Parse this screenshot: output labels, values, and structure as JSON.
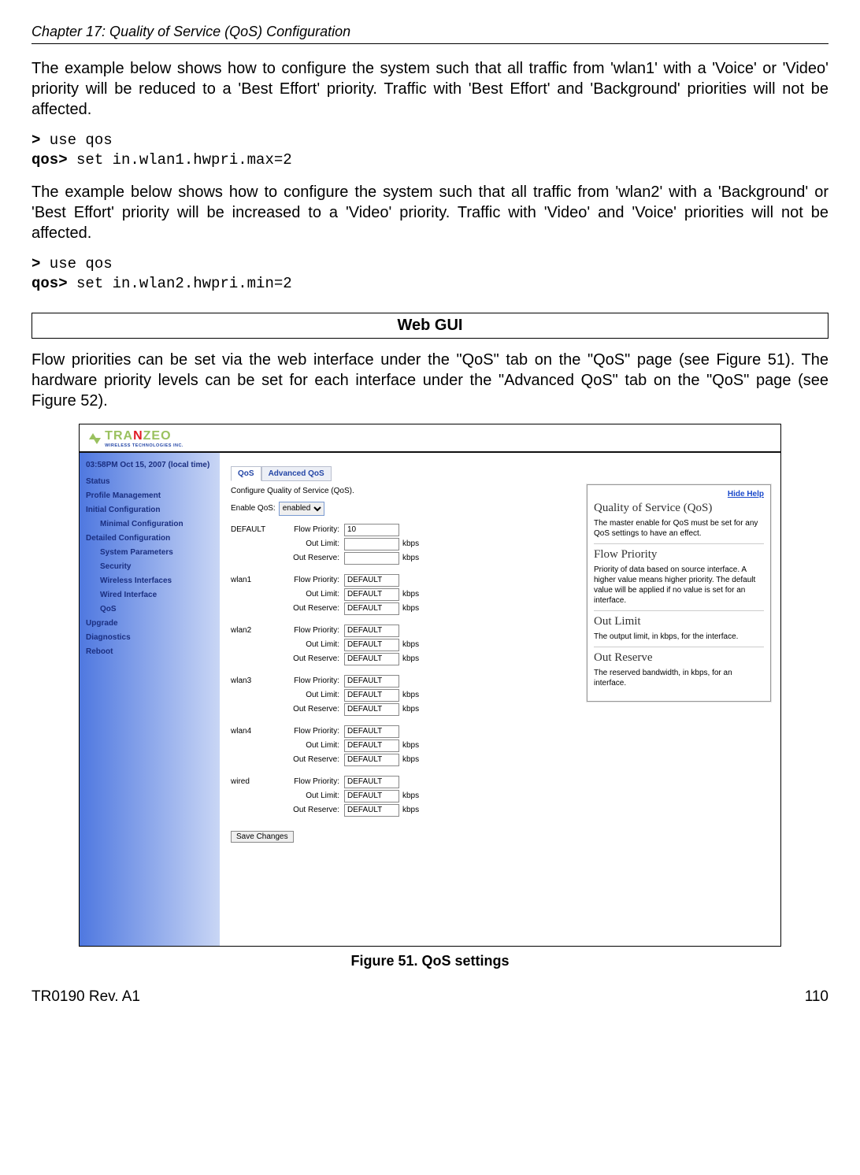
{
  "chapter": "Chapter 17: Quality of Service (QoS) Configuration",
  "para1": "The example below shows how to configure the system such that all traffic from 'wlan1' with a 'Voice' or 'Video' priority will be reduced to a 'Best Effort' priority. Traffic with 'Best Effort' and 'Background' priorities will not be affected.",
  "cli1_prompt1": ">",
  "cli1_cmd1": " use qos",
  "cli1_prompt2": "qos>",
  "cli1_cmd2": " set in.wlan1.hwpri.max=2",
  "para2": "The example below shows how to configure the system such that all traffic from 'wlan2' with a 'Background' or 'Best Effort' priority will be increased to a 'Video' priority. Traffic with 'Video' and 'Voice' priorities will not be affected.",
  "cli2_prompt1": ">",
  "cli2_cmd1": " use qos",
  "cli2_prompt2": "qos>",
  "cli2_cmd2": " set in.wlan2.hwpri.min=2",
  "webgui_title": "Web GUI",
  "para3": "Flow priorities can be set via the web interface under the \"QoS\" tab on the \"QoS\" page (see Figure 51). The hardware priority levels can be set for each interface under the \"Advanced QoS\" tab on the \"QoS\" page (see Figure 52).",
  "brand_main": "TRA",
  "brand_split": "N",
  "brand_end": "ZEO",
  "brand_sub": "WIRELESS TECHNOLOGIES INC.",
  "sidebar": {
    "localtime": "03:58PM Oct 15, 2007 (local time)",
    "items": [
      "Status",
      "Profile Management",
      "Initial Configuration",
      "Minimal Configuration",
      "Detailed Configuration",
      "System Parameters",
      "Security",
      "Wireless Interfaces",
      "Wired Interface",
      "QoS",
      "Upgrade",
      "Diagnostics",
      "Reboot"
    ]
  },
  "tabs": {
    "qos": "QoS",
    "adv": "Advanced QoS"
  },
  "desc": "Configure Quality of Service (QoS).",
  "enable_label": "Enable QoS:",
  "enable_value": "enabled",
  "labels": {
    "flow": "Flow Priority:",
    "outlimit": "Out Limit:",
    "outreserve": "Out Reserve:",
    "kbps": "kbps"
  },
  "interfaces": [
    {
      "name": "DEFAULT",
      "flow": "10",
      "outlimit": "",
      "outreserve": ""
    },
    {
      "name": "wlan1",
      "flow": "DEFAULT",
      "outlimit": "DEFAULT",
      "outreserve": "DEFAULT"
    },
    {
      "name": "wlan2",
      "flow": "DEFAULT",
      "outlimit": "DEFAULT",
      "outreserve": "DEFAULT"
    },
    {
      "name": "wlan3",
      "flow": "DEFAULT",
      "outlimit": "DEFAULT",
      "outreserve": "DEFAULT"
    },
    {
      "name": "wlan4",
      "flow": "DEFAULT",
      "outlimit": "DEFAULT",
      "outreserve": "DEFAULT"
    },
    {
      "name": "wired",
      "flow": "DEFAULT",
      "outlimit": "DEFAULT",
      "outreserve": "DEFAULT"
    }
  ],
  "save": "Save Changes",
  "help": {
    "hide": "Hide Help",
    "h1": "Quality of Service (QoS)",
    "p1": "The master enable for QoS must be set for any QoS settings to have an effect.",
    "h2": "Flow Priority",
    "p2": "Priority of data based on source interface. A higher value means higher priority. The default value will be applied if no value is set for an interface.",
    "h3": "Out Limit",
    "p3": "The output limit, in kbps, for the interface.",
    "h4": "Out Reserve",
    "p4": "The reserved bandwidth, in kbps, for an interface."
  },
  "fig_caption": "Figure 51. QoS settings",
  "footer_left": "TR0190 Rev. A1",
  "footer_right": "110"
}
